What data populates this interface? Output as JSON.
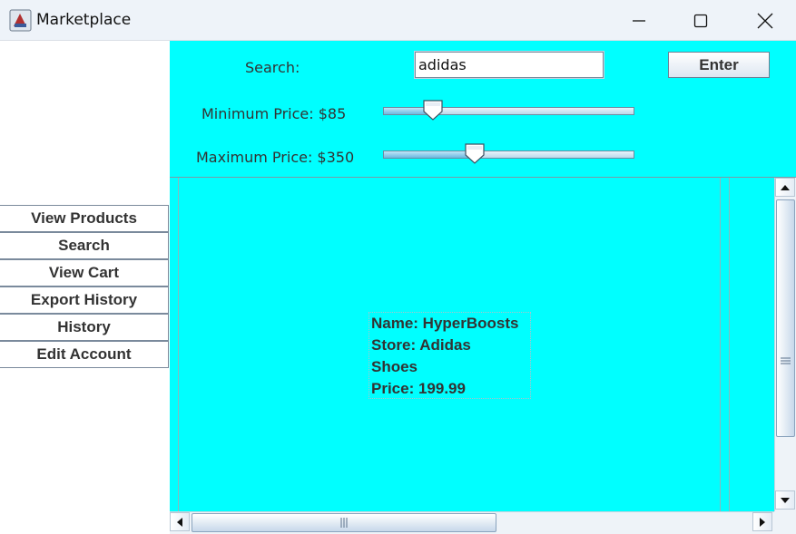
{
  "window": {
    "title": "Marketplace",
    "icon": "java-app-icon"
  },
  "window_controls": [
    "minimize-icon",
    "maximize-icon",
    "close-icon"
  ],
  "nav": {
    "items": [
      {
        "label": "View Products"
      },
      {
        "label": "Search"
      },
      {
        "label": "View Cart"
      },
      {
        "label": "Export History"
      },
      {
        "label": "History"
      },
      {
        "label": "Edit Account"
      }
    ]
  },
  "filters": {
    "search_label": "Search:",
    "search_value": "adidas",
    "enter_label": "Enter",
    "min_price_label": "Minimum Price: $85",
    "max_price_label": "Maximum Price: $350",
    "min_slider_level": 0.17,
    "max_slider_level": 0.35
  },
  "results": {
    "products": [
      {
        "name": "Name: HyperBoosts",
        "store": "Store: Adidas",
        "category": "Shoes",
        "price": "Price: 199.99"
      }
    ]
  },
  "colors": {
    "panel_bg": "#00ffff",
    "titlebar_bg": "#eef3f9",
    "accent": "#7a8a9c"
  }
}
